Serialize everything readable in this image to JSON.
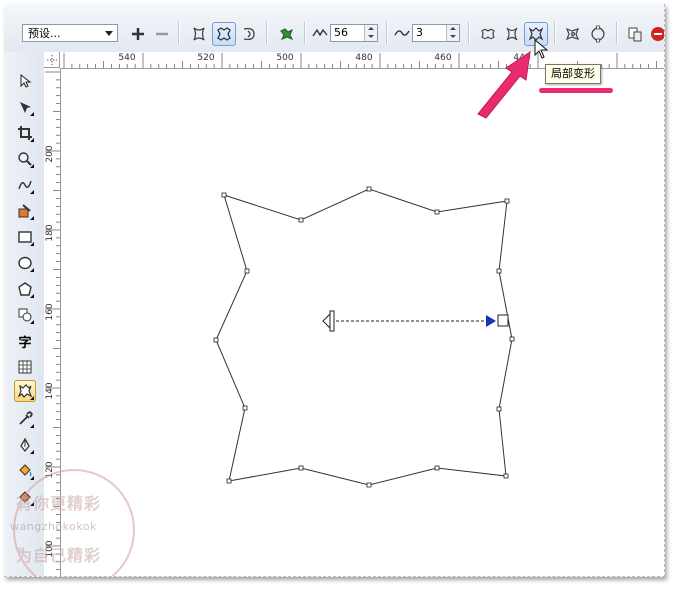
{
  "toolbar": {
    "preset_value": "预设...",
    "frequency_value": "56",
    "amplitude_value": "3",
    "tooltip": "局部变形"
  },
  "ruler": {
    "horizontal": [
      "540",
      "520",
      "500",
      "480",
      "460",
      "440"
    ],
    "vertical": [
      "200",
      "180",
      "160",
      "140",
      "120",
      "100"
    ]
  },
  "toolbox": {
    "text_tool_label": "字"
  },
  "watermark": {
    "line1": "有你更精彩",
    "line2": "wangzhokokok",
    "line3": "为自己精彩"
  },
  "colors": {
    "highlight_arrow": "#ea2b6d",
    "handle_blue": "#1e2fb8"
  }
}
